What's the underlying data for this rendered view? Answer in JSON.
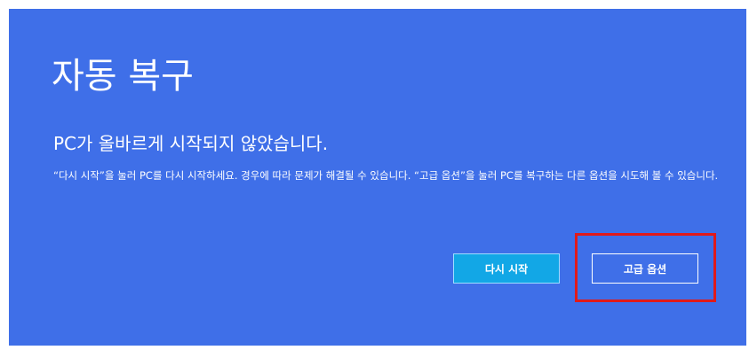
{
  "title": "자동 복구",
  "subtitle": "PC가 올바르게 시작되지 않았습니다.",
  "description": "“다시 시작”을 눌러 PC를 다시 시작하세요. 경우에 따라 문제가 해결될 수 있습니다. “고급 옵션”을 눌러 PC를 복구하는 다른 옵션을 시도해 볼 수 있습니다.",
  "buttons": {
    "restart_label": "다시 시작",
    "advanced_label": "고급 옵션"
  },
  "colors": {
    "background": "#3f6fe8",
    "restart_button": "#12a7e6",
    "highlight_box": "#e01a1a"
  }
}
